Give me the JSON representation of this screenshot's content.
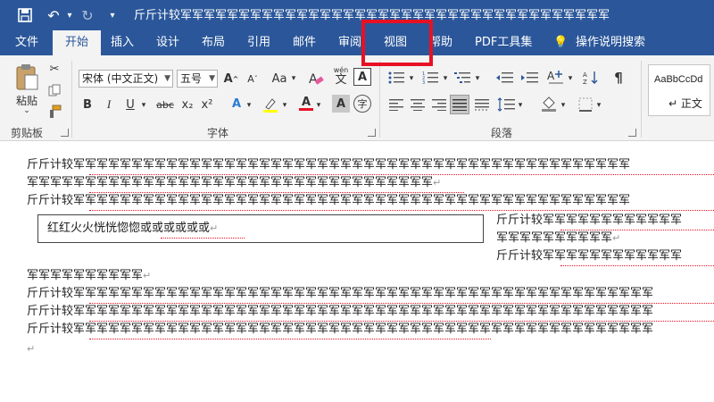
{
  "titlebar": {
    "save_icon": "save-icon",
    "undo_icon": "undo-icon",
    "redo_icon": "redo-icon",
    "customize_icon": "customize-arrow-icon",
    "title": "斤斤计较军军军军军军军军军军军军军军军军军军军军军军军军军军军军军军军军军军军军军"
  },
  "tabs": [
    {
      "label": "文件"
    },
    {
      "label": "开始"
    },
    {
      "label": "插入"
    },
    {
      "label": "设计"
    },
    {
      "label": "布局"
    },
    {
      "label": "引用"
    },
    {
      "label": "邮件"
    },
    {
      "label": "审阅"
    },
    {
      "label": "视图"
    },
    {
      "label": "帮助"
    },
    {
      "label": "PDF工具集"
    },
    {
      "label": "操作说明搜索"
    }
  ],
  "clipboard": {
    "paste_label": "粘贴",
    "group_label": "剪贴板"
  },
  "font": {
    "font_name": "宋体 (中文正文)",
    "font_size": "五号",
    "group_label": "字体",
    "phonetic_label": "wén",
    "bold": "B",
    "italic": "I",
    "underline": "U",
    "strike": "abc",
    "subscript": "x₂",
    "superscript": "x²",
    "font_color": "A",
    "highlight": "A",
    "enclose": "字"
  },
  "paragraph": {
    "group_label": "段落"
  },
  "styles": {
    "sample": "AaBbCcDd",
    "name": "↵ 正文"
  },
  "document": {
    "lines": [
      "斤斤计较军军军军军军军军军军军军军军军军军军军军军军军军军军军军军军军军军军军军军军军军军军军军军军军军",
      "军军军军军军军军军军军军军军军军军军军军军军军军军军军军军军军军军军军",
      "斤斤计较军军军军军军军军军军军军军军军军军军军军军军军军军军军军军军军军军军军军军军军军军军军军军军军军"
    ],
    "textbox_text": "红红火火恍恍惚惚或或或或或或",
    "right_line1": "斤斤计较军军军军军军军军军军军军",
    "right_line2": "军军军军军军军军军军",
    "right_line3": "斤斤计较军军军军军军军军军军军军",
    "line_after": "军军军军军军军军军军",
    "lines_bottom": [
      "斤斤计较军军军军军军军军军军军军军军军军军军军军军军军军军军军军军军军军军军军军军军军军军军军军军军军军军军",
      "斤斤计较军军军军军军军军军军军军军军军军军军军军军军军军军军军军军军军军军军军军军军军军军军军军军军军军军军",
      "斤斤计较军军军军军军军军军军军军军军军军军军军军军军军军军军军军军军军军军军军军军军军军军军军军军军军军军军"
    ],
    "para_mark": "↵"
  },
  "colors": {
    "ribbon_blue": "#2b579a",
    "highlight_box": "#e81123",
    "squiggle": "#e81123"
  }
}
